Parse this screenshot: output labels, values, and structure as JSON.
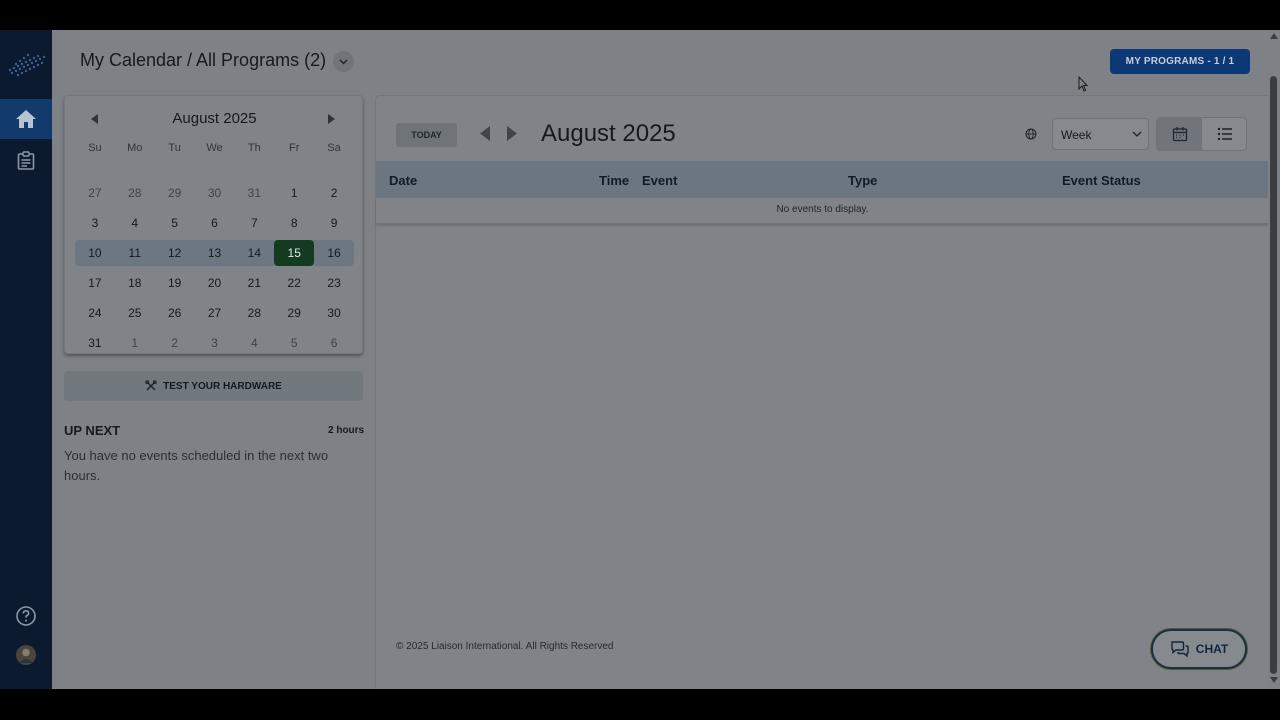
{
  "header": {
    "title": "My Calendar / All Programs (2)",
    "my_programs_label": "MY PROGRAMS - 1 / 1"
  },
  "rail": {
    "items": [
      {
        "icon": "home-icon",
        "active": true
      },
      {
        "icon": "clipboard-icon",
        "active": false
      },
      {
        "icon": "help-icon",
        "active": false
      },
      {
        "icon": "avatar",
        "active": false
      }
    ]
  },
  "mini_calendar": {
    "month": "August 2025",
    "weekdays": [
      "Su",
      "Mo",
      "Tu",
      "We",
      "Th",
      "Fr",
      "Sa"
    ],
    "weeks": [
      [
        "27",
        "28",
        "29",
        "30",
        "31",
        "1",
        "2"
      ],
      [
        "3",
        "4",
        "5",
        "6",
        "7",
        "8",
        "9"
      ],
      [
        "10",
        "11",
        "12",
        "13",
        "14",
        "15",
        "16"
      ],
      [
        "17",
        "18",
        "19",
        "20",
        "21",
        "22",
        "23"
      ],
      [
        "24",
        "25",
        "26",
        "27",
        "28",
        "29",
        "30"
      ],
      [
        "31",
        "1",
        "2",
        "3",
        "4",
        "5",
        "6"
      ]
    ],
    "selected_week_index": 2,
    "today": "15"
  },
  "test_hardware_label": "TEST YOUR HARDWARE",
  "up_next": {
    "title": "UP NEXT",
    "window": "2 hours",
    "message": "You have no events scheduled in the next two hours."
  },
  "main": {
    "today_label": "TODAY",
    "month": "August 2025",
    "view_selected": "Week",
    "columns": [
      "Date",
      "Time",
      "Event",
      "Type",
      "Event Status"
    ],
    "empty_message": "No events to display."
  },
  "footer": {
    "copyright": "© 2025 Liaison International. All Rights Reserved"
  },
  "chat_label": "CHAT",
  "colors": {
    "brand_navy": "#0c3875",
    "today_green": "#143a1f",
    "rail_bg": "#0c1a30"
  }
}
